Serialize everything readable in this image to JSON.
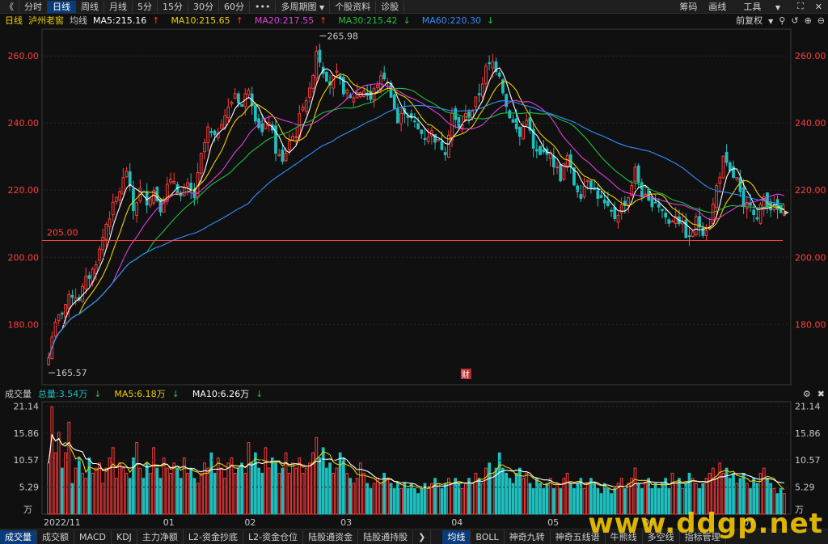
{
  "toolbar": {
    "back": "《",
    "periods": [
      "分时",
      "日线",
      "周线",
      "月线",
      "5分",
      "15分",
      "30分",
      "60分"
    ],
    "active_period": "日线",
    "more": "•••",
    "multi_period": "多周期图",
    "multi_arrow": "▼",
    "stock_info": "个股资料",
    "diagnose": "诊股",
    "right": [
      "筹码",
      "画线",
      "工具"
    ],
    "tools_arrow": "▼",
    "fullscreen_glyph": "⛶",
    "close_glyph": "✕"
  },
  "info": {
    "period_label": "日线",
    "stock_name": "泸州老窖",
    "avg_label": "均线",
    "ma5": "MA5:215.16",
    "ma5_arrow": "↑",
    "ma10": "MA10:215.65",
    "ma10_arrow": "↑",
    "ma20": "MA20:217.55",
    "ma20_arrow": "↑",
    "ma30": "MA30:215.42",
    "ma30_arrow": "↓",
    "ma60": "MA60:220.30",
    "ma60_arrow": "↓",
    "adjust": "前复权",
    "adjust_arrow": "▼"
  },
  "volume_info": {
    "label": "成交量",
    "total": "总量:3.54万",
    "total_arrow": "↓",
    "ma5": "MA5:6.18万",
    "ma5_arrow": "↓",
    "ma10": "MA10:6.26万",
    "ma10_arrow": "↓"
  },
  "chart_data": {
    "type": "candlestick",
    "price_axis": {
      "ticks": [
        "260.00",
        "240.00",
        "220.00",
        "200.00",
        "180.00"
      ],
      "ylim": [
        162,
        268
      ]
    },
    "volume_axis": {
      "ticks": [
        "21.14",
        "15.86",
        "10.57",
        "5.29"
      ],
      "unit": "万",
      "ylim": [
        0,
        22
      ]
    },
    "x_labels": [
      "2022/11",
      "01",
      "02",
      "03",
      "04",
      "05",
      "06",
      "07"
    ],
    "annotations": {
      "high": "265.98",
      "low": "165.57",
      "support": "205.00",
      "fin_marker": "财"
    },
    "support_level": 205,
    "colors": {
      "up": "#ff3b3b",
      "down": "#1fbfbf",
      "ma5": "#ffffff",
      "ma10": "#f0d000",
      "ma20": "#e040e0",
      "ma30": "#20c040",
      "ma60": "#3090ff"
    },
    "anchors": [
      [
        0,
        170
      ],
      [
        1,
        177
      ],
      [
        3,
        182
      ],
      [
        5,
        186
      ],
      [
        7,
        189
      ],
      [
        9,
        188
      ],
      [
        11,
        193
      ],
      [
        13,
        196
      ],
      [
        15,
        202
      ],
      [
        17,
        210
      ],
      [
        19,
        215
      ],
      [
        21,
        220
      ],
      [
        23,
        226
      ],
      [
        25,
        214
      ],
      [
        27,
        220
      ],
      [
        29,
        217
      ],
      [
        31,
        220
      ],
      [
        33,
        215
      ],
      [
        35,
        221
      ],
      [
        37,
        223
      ],
      [
        39,
        218
      ],
      [
        41,
        221
      ],
      [
        43,
        218
      ],
      [
        45,
        230
      ],
      [
        47,
        238
      ],
      [
        49,
        235
      ],
      [
        51,
        241
      ],
      [
        53,
        244
      ],
      [
        55,
        249
      ],
      [
        57,
        245
      ],
      [
        59,
        251
      ],
      [
        61,
        242
      ],
      [
        63,
        237
      ],
      [
        65,
        241
      ],
      [
        67,
        232
      ],
      [
        69,
        228
      ],
      [
        71,
        235
      ],
      [
        73,
        237
      ],
      [
        75,
        246
      ],
      [
        77,
        249
      ],
      [
        79,
        262
      ],
      [
        81,
        256
      ],
      [
        83,
        252
      ],
      [
        85,
        254
      ],
      [
        87,
        250
      ],
      [
        89,
        247
      ],
      [
        91,
        249
      ],
      [
        93,
        250
      ],
      [
        95,
        247
      ],
      [
        97,
        252
      ],
      [
        99,
        254
      ],
      [
        101,
        249
      ],
      [
        103,
        240
      ],
      [
        105,
        244
      ],
      [
        107,
        241
      ],
      [
        109,
        238
      ],
      [
        111,
        236
      ],
      [
        113,
        237
      ],
      [
        115,
        234
      ],
      [
        117,
        232
      ],
      [
        119,
        243
      ],
      [
        121,
        238
      ],
      [
        123,
        242
      ],
      [
        125,
        244
      ],
      [
        127,
        249
      ],
      [
        129,
        256
      ],
      [
        131,
        258
      ],
      [
        133,
        255
      ],
      [
        135,
        245
      ],
      [
        137,
        240
      ],
      [
        139,
        236
      ],
      [
        141,
        242
      ],
      [
        143,
        232
      ],
      [
        145,
        230
      ],
      [
        147,
        232
      ],
      [
        149,
        228
      ],
      [
        151,
        224
      ],
      [
        153,
        230
      ],
      [
        155,
        222
      ],
      [
        157,
        219
      ],
      [
        159,
        224
      ],
      [
        161,
        220
      ],
      [
        163,
        217
      ],
      [
        165,
        214
      ],
      [
        167,
        212
      ],
      [
        169,
        215
      ],
      [
        171,
        218
      ],
      [
        173,
        226
      ],
      [
        175,
        219
      ],
      [
        177,
        216
      ],
      [
        179,
        217
      ],
      [
        181,
        214
      ],
      [
        183,
        210
      ],
      [
        185,
        213
      ],
      [
        187,
        209
      ],
      [
        189,
        205
      ],
      [
        191,
        211
      ],
      [
        193,
        208
      ],
      [
        195,
        210
      ],
      [
        197,
        221
      ],
      [
        199,
        229
      ],
      [
        201,
        225
      ],
      [
        203,
        223
      ],
      [
        205,
        214
      ],
      [
        207,
        217
      ],
      [
        209,
        211
      ],
      [
        211,
        218
      ],
      [
        213,
        215
      ],
      [
        215,
        214
      ],
      [
        217,
        212
      ]
    ],
    "volume_anchors": [
      [
        0,
        10
      ],
      [
        1,
        21
      ],
      [
        2,
        12
      ],
      [
        3,
        16
      ],
      [
        4,
        9
      ],
      [
        5,
        12
      ],
      [
        6,
        18
      ],
      [
        7,
        6
      ],
      [
        8,
        9
      ],
      [
        9,
        11
      ],
      [
        10,
        8
      ],
      [
        11,
        7
      ],
      [
        12,
        11
      ],
      [
        13,
        8
      ],
      [
        14,
        9
      ],
      [
        15,
        10
      ],
      [
        16,
        6
      ],
      [
        17,
        9
      ],
      [
        18,
        11
      ],
      [
        19,
        13
      ],
      [
        20,
        7
      ],
      [
        21,
        10
      ],
      [
        22,
        9
      ],
      [
        23,
        8
      ],
      [
        24,
        7
      ],
      [
        25,
        11
      ],
      [
        26,
        14
      ],
      [
        27,
        9
      ],
      [
        28,
        7
      ],
      [
        29,
        10
      ],
      [
        30,
        8
      ],
      [
        31,
        13
      ],
      [
        32,
        9
      ],
      [
        33,
        7
      ],
      [
        34,
        11
      ],
      [
        35,
        9
      ],
      [
        36,
        8
      ],
      [
        37,
        10
      ],
      [
        38,
        9
      ],
      [
        39,
        7
      ],
      [
        40,
        11
      ],
      [
        41,
        8
      ],
      [
        42,
        9
      ],
      [
        43,
        7
      ],
      [
        44,
        6
      ],
      [
        45,
        8
      ],
      [
        46,
        10
      ],
      [
        47,
        9
      ],
      [
        48,
        12
      ],
      [
        49,
        8
      ],
      [
        50,
        11
      ],
      [
        51,
        9
      ],
      [
        52,
        7
      ],
      [
        53,
        10
      ],
      [
        54,
        11
      ],
      [
        55,
        8
      ],
      [
        56,
        9
      ],
      [
        57,
        10
      ],
      [
        58,
        8
      ],
      [
        59,
        14
      ],
      [
        60,
        10
      ],
      [
        61,
        12
      ],
      [
        62,
        9
      ],
      [
        63,
        8
      ],
      [
        64,
        13
      ],
      [
        65,
        9
      ],
      [
        66,
        11
      ],
      [
        67,
        10
      ],
      [
        68,
        8
      ],
      [
        69,
        9
      ],
      [
        70,
        12
      ],
      [
        71,
        8
      ],
      [
        72,
        10
      ],
      [
        73,
        9
      ],
      [
        74,
        11
      ],
      [
        75,
        8
      ],
      [
        76,
        9
      ],
      [
        77,
        10
      ],
      [
        78,
        12
      ],
      [
        79,
        15
      ],
      [
        80,
        11
      ],
      [
        81,
        13
      ],
      [
        82,
        9
      ],
      [
        83,
        10
      ],
      [
        84,
        8
      ],
      [
        85,
        9
      ],
      [
        86,
        12
      ],
      [
        87,
        11
      ],
      [
        88,
        8
      ],
      [
        89,
        7
      ],
      [
        90,
        6
      ],
      [
        91,
        7
      ],
      [
        92,
        10
      ],
      [
        93,
        8
      ],
      [
        94,
        6
      ],
      [
        95,
        5
      ],
      [
        96,
        6
      ],
      [
        97,
        7
      ],
      [
        98,
        6
      ],
      [
        99,
        8
      ],
      [
        100,
        7
      ],
      [
        101,
        6
      ],
      [
        102,
        5
      ],
      [
        103,
        6
      ],
      [
        104,
        5
      ],
      [
        105,
        6
      ],
      [
        106,
        5
      ],
      [
        107,
        6
      ],
      [
        108,
        5
      ],
      [
        109,
        4
      ],
      [
        110,
        5
      ],
      [
        111,
        6
      ],
      [
        112,
        5
      ],
      [
        113,
        6
      ],
      [
        114,
        7
      ],
      [
        115,
        6
      ],
      [
        116,
        5
      ],
      [
        117,
        6
      ],
      [
        118,
        7
      ],
      [
        119,
        6
      ],
      [
        120,
        7
      ],
      [
        121,
        6
      ],
      [
        122,
        5
      ],
      [
        123,
        6
      ],
      [
        124,
        7
      ],
      [
        125,
        6
      ],
      [
        126,
        8
      ],
      [
        127,
        7
      ],
      [
        128,
        6
      ],
      [
        129,
        9
      ],
      [
        130,
        10
      ],
      [
        131,
        8
      ],
      [
        132,
        9
      ],
      [
        133,
        12
      ],
      [
        134,
        9
      ],
      [
        135,
        8
      ],
      [
        136,
        7
      ],
      [
        137,
        6
      ],
      [
        138,
        8
      ],
      [
        139,
        9
      ],
      [
        140,
        7
      ],
      [
        141,
        8
      ],
      [
        142,
        6
      ],
      [
        143,
        5
      ],
      [
        144,
        7
      ],
      [
        145,
        6
      ],
      [
        146,
        5
      ],
      [
        147,
        6
      ],
      [
        148,
        7
      ],
      [
        149,
        5
      ],
      [
        150,
        6
      ],
      [
        151,
        5
      ],
      [
        152,
        7
      ],
      [
        153,
        8
      ],
      [
        154,
        6
      ],
      [
        155,
        5
      ],
      [
        156,
        6
      ],
      [
        157,
        7
      ],
      [
        158,
        5
      ],
      [
        159,
        6
      ],
      [
        160,
        7
      ],
      [
        161,
        6
      ],
      [
        162,
        5
      ],
      [
        163,
        4
      ],
      [
        164,
        6
      ],
      [
        165,
        5
      ],
      [
        166,
        4
      ],
      [
        167,
        5
      ],
      [
        168,
        6
      ],
      [
        169,
        7
      ],
      [
        170,
        5
      ],
      [
        171,
        6
      ],
      [
        172,
        7
      ],
      [
        173,
        9
      ],
      [
        174,
        6
      ],
      [
        175,
        5
      ],
      [
        176,
        6
      ],
      [
        177,
        7
      ],
      [
        178,
        5
      ],
      [
        179,
        6
      ],
      [
        180,
        5
      ],
      [
        181,
        6
      ],
      [
        182,
        7
      ],
      [
        183,
        5
      ],
      [
        184,
        8
      ],
      [
        185,
        6
      ],
      [
        186,
        7
      ],
      [
        187,
        5
      ],
      [
        188,
        6
      ],
      [
        189,
        8
      ],
      [
        190,
        7
      ],
      [
        191,
        6
      ],
      [
        192,
        5
      ],
      [
        193,
        6
      ],
      [
        194,
        7
      ],
      [
        195,
        8
      ],
      [
        196,
        9
      ],
      [
        197,
        7
      ],
      [
        198,
        10
      ],
      [
        199,
        8
      ],
      [
        200,
        9
      ],
      [
        201,
        7
      ],
      [
        202,
        8
      ],
      [
        203,
        6
      ],
      [
        204,
        7
      ],
      [
        205,
        8
      ],
      [
        206,
        6
      ],
      [
        207,
        5
      ],
      [
        208,
        7
      ],
      [
        209,
        6
      ],
      [
        210,
        8
      ],
      [
        211,
        9
      ],
      [
        212,
        7
      ],
      [
        213,
        6
      ],
      [
        214,
        5
      ],
      [
        215,
        4
      ],
      [
        216,
        5
      ],
      [
        217,
        4
      ]
    ]
  },
  "bottom_tabs": {
    "left": [
      "成交量",
      "成交额",
      "MACD",
      "KDJ",
      "主力净额",
      "L2-资金抄底",
      "L2-资金仓位",
      "陆股通资金",
      "陆股通持股"
    ],
    "scroll_arrow": "❯",
    "right": [
      "均线",
      "BOLL",
      "神奇九转",
      "神奇五线谱",
      "牛熊线",
      "多空线",
      "指标管理"
    ],
    "active_left": "成交量",
    "active_right": "均线"
  },
  "watermark": "www.ddgp.net"
}
